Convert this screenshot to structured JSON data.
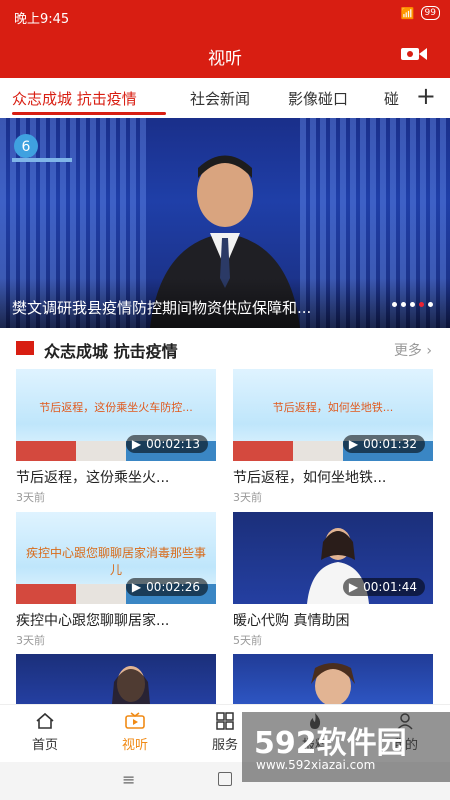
{
  "status_bar": {
    "time": "晚上9:45",
    "battery": "99"
  },
  "header": {
    "title": "视听"
  },
  "tabs": [
    {
      "label": "众志成城 抗击疫情"
    },
    {
      "label": "社会新闻"
    },
    {
      "label": "影像碰口"
    },
    {
      "label": "碰"
    }
  ],
  "banner": {
    "title": "樊文调研我县疫情防控期间物资供应保障和..."
  },
  "section": {
    "title": "众志成城 抗击疫情",
    "more": "更多"
  },
  "videos": [
    {
      "title": "节后返程，这份乘坐火...",
      "duration": "00:02:13",
      "time": "3天前",
      "thumb_text": "节后返程，这份乘坐火车防控..."
    },
    {
      "title": "节后返程，如何坐地铁...",
      "duration": "00:01:32",
      "time": "3天前",
      "thumb_text": "节后返程，如何坐地铁..."
    },
    {
      "title": "疾控中心跟您聊聊居家...",
      "duration": "00:02:26",
      "time": "3天前",
      "thumb_text": "疾控中心跟您聊聊居家消毒那些事儿"
    },
    {
      "title": "暖心代购 真情助困",
      "duration": "00:01:44",
      "time": "5天前"
    }
  ],
  "bottom_nav": [
    {
      "label": "首页",
      "icon": "home-icon"
    },
    {
      "label": "视听",
      "icon": "tv-icon"
    },
    {
      "label": "服务",
      "icon": "grid-icon"
    },
    {
      "label": "报料",
      "icon": "flame-icon"
    },
    {
      "label": "我的",
      "icon": "user-icon"
    }
  ],
  "watermark": {
    "text": "592软件园",
    "url": "www.592xiazai.com"
  },
  "colors": {
    "brand_red": "#d81e12",
    "accent_orange": "#f08a15"
  }
}
